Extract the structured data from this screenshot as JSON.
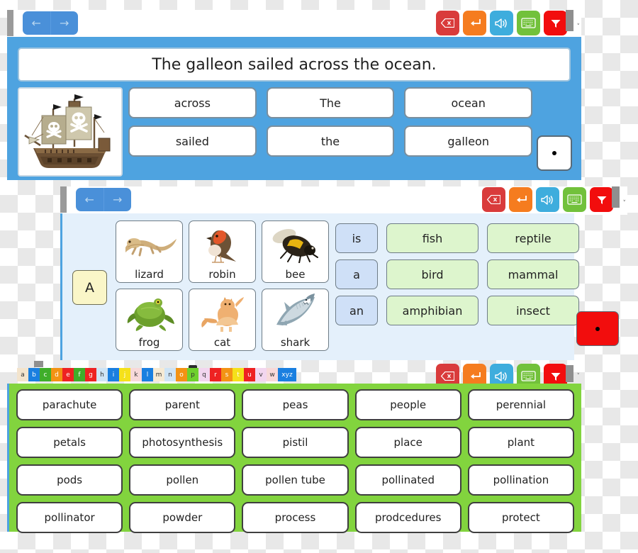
{
  "toolbar": {
    "nav_back": "back-arrow",
    "nav_forward": "forward-arrow",
    "tools": [
      {
        "name": "backspace-button",
        "icon": "backspace-icon",
        "color": "#d93b3b"
      },
      {
        "name": "enter-button",
        "icon": "enter-return-icon",
        "color": "#f57c1f"
      },
      {
        "name": "speak-button",
        "icon": "megaphone-speaker-icon",
        "color": "#3eaddd"
      },
      {
        "name": "keyboard-button",
        "icon": "keyboard-icon",
        "color": "#72c13b"
      },
      {
        "name": "collapse-button",
        "icon": "funnel-down-icon",
        "color": "#f20d0d"
      }
    ],
    "chevron": "˅"
  },
  "panel1": {
    "sentence": "The galleon sailed across the ocean.",
    "picture_alt": "pirate-galleon-ship",
    "word_rows": [
      [
        "across",
        "The",
        "ocean"
      ],
      [
        "sailed",
        "the",
        "galleon"
      ]
    ],
    "period_tile": "."
  },
  "panel2": {
    "article_tile": "A",
    "animal_rows": [
      [
        {
          "label": "lizard",
          "image": "lizard-photo"
        },
        {
          "label": "robin",
          "image": "robin-bird-photo"
        },
        {
          "label": "bee",
          "image": "bumblebee-photo"
        }
      ],
      [
        {
          "label": "frog",
          "image": "frog-photo"
        },
        {
          "label": "cat",
          "image": "ginger-cat-photo"
        },
        {
          "label": "shark",
          "image": "shark-photo"
        }
      ]
    ],
    "determiners": [
      "is",
      "a",
      "an"
    ],
    "category_rows": [
      [
        "fish",
        "reptile"
      ],
      [
        "bird",
        "mammal"
      ],
      [
        "amphibian",
        "insect"
      ]
    ],
    "period_tile": ".",
    "period_tile_color": "#f20d0d"
  },
  "panel3": {
    "alphabet": [
      {
        "letter": "a",
        "color": "#f3e4cd",
        "text": "#333333",
        "selected": false
      },
      {
        "letter": "b",
        "color": "#1a7fe0",
        "text": "#ffffff",
        "selected": false
      },
      {
        "letter": "c",
        "color": "#3fae2a",
        "text": "#ffffff",
        "selected": false
      },
      {
        "letter": "d",
        "color": "#f39314",
        "text": "#ffffff",
        "selected": false
      },
      {
        "letter": "e",
        "color": "#ee2222",
        "text": "#ffffff",
        "selected": false
      },
      {
        "letter": "f",
        "color": "#3fae2a",
        "text": "#ffffff",
        "selected": false
      },
      {
        "letter": "g",
        "color": "#ee2222",
        "text": "#ffffff",
        "selected": false
      },
      {
        "letter": "h",
        "color": "#cfe4f5",
        "text": "#333333",
        "selected": false
      },
      {
        "letter": "i",
        "color": "#1a7fe0",
        "text": "#ffffff",
        "selected": false
      },
      {
        "letter": "j",
        "color": "#f5e11a",
        "text": "#ffffff",
        "selected": false
      },
      {
        "letter": "k",
        "color": "#f7d9d9",
        "text": "#333333",
        "selected": false
      },
      {
        "letter": "l",
        "color": "#1a7fe0",
        "text": "#ffffff",
        "selected": false
      },
      {
        "letter": "m",
        "color": "#f6ead4",
        "text": "#333333",
        "selected": false
      },
      {
        "letter": "n",
        "color": "#cfe4f5",
        "text": "#333333",
        "selected": false
      },
      {
        "letter": "o",
        "color": "#f39314",
        "text": "#ffffff",
        "selected": false
      },
      {
        "letter": "p",
        "color": "#6fd12e",
        "text": "#333333",
        "selected": true
      },
      {
        "letter": "q",
        "color": "#f2d6ef",
        "text": "#333333",
        "selected": false
      },
      {
        "letter": "r",
        "color": "#ee2222",
        "text": "#ffffff",
        "selected": false
      },
      {
        "letter": "s",
        "color": "#f39314",
        "text": "#ffffff",
        "selected": false
      },
      {
        "letter": "t",
        "color": "#f5e11a",
        "text": "#ffffff",
        "selected": false
      },
      {
        "letter": "u",
        "color": "#ee2222",
        "text": "#ffffff",
        "selected": false
      },
      {
        "letter": "v",
        "color": "#f2d6ef",
        "text": "#333333",
        "selected": false
      },
      {
        "letter": "w",
        "color": "#f7d9d9",
        "text": "#333333",
        "selected": false
      },
      {
        "letter": "xyz",
        "color": "#1a7fe0",
        "text": "#ffffff",
        "selected": false
      }
    ],
    "word_rows": [
      [
        "parachute",
        "parent",
        "peas",
        "people",
        "perennial"
      ],
      [
        "petals",
        "photosynthesis",
        "pistil",
        "place",
        "plant"
      ],
      [
        "pods",
        "pollen",
        "pollen tube",
        "pollinated",
        "pollination"
      ],
      [
        "pollinator",
        "powder",
        "process",
        "prodcedures",
        "protect"
      ]
    ]
  }
}
